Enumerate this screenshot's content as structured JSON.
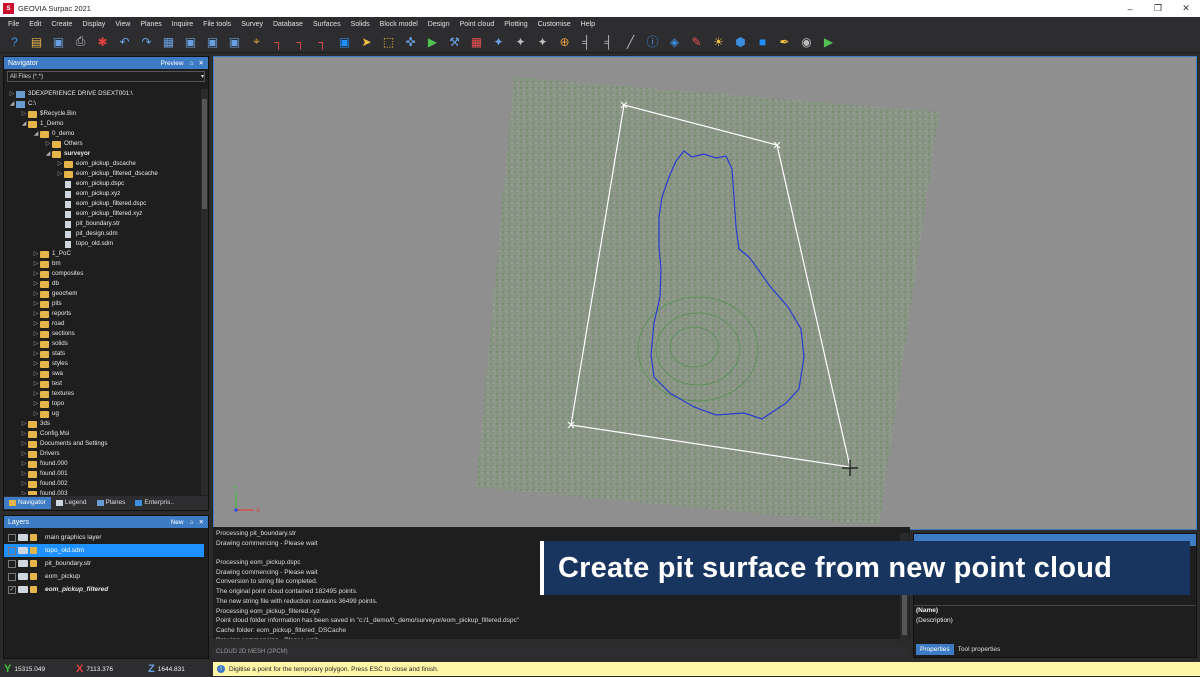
{
  "window": {
    "title": "GEOVIA Surpac 2021",
    "app_icon_letter": "S",
    "minimize": "–",
    "restore": "❐",
    "close": "✕"
  },
  "menu": [
    "File",
    "Edit",
    "Create",
    "Display",
    "View",
    "Planes",
    "Inquire",
    "File tools",
    "Survey",
    "Database",
    "Surfaces",
    "Solids",
    "Block model",
    "Design",
    "Point cloud",
    "Plotting",
    "Customise",
    "Help"
  ],
  "toolbar": [
    {
      "name": "help-icon",
      "glyph": "?",
      "color": "#3d8fe0"
    },
    {
      "name": "open-icon",
      "glyph": "▤",
      "color": "#e6b54a"
    },
    {
      "name": "save-icon",
      "glyph": "▣",
      "color": "#6aa0e0"
    },
    {
      "name": "print-icon",
      "glyph": "⎙",
      "color": "#bbbbbb"
    },
    {
      "name": "snowflake-icon",
      "glyph": "✱",
      "color": "#e84040"
    },
    {
      "name": "undo-icon",
      "glyph": "↶",
      "color": "#6aa0e0"
    },
    {
      "name": "redo-icon",
      "glyph": "↷",
      "color": "#6aa0e0"
    },
    {
      "name": "grid-icon",
      "glyph": "▦",
      "color": "#6aa0e0"
    },
    {
      "name": "zoom-in-icon",
      "glyph": "▣",
      "color": "#6aa0e0"
    },
    {
      "name": "zoom-window-icon",
      "glyph": "▣",
      "color": "#6aa0e0"
    },
    {
      "name": "zoom-out-icon",
      "glyph": "▣",
      "color": "#6aa0e0"
    },
    {
      "name": "target-icon",
      "glyph": "⌖",
      "color": "#e8a040"
    },
    {
      "name": "axis-x-icon",
      "glyph": "┐",
      "color": "#e85050"
    },
    {
      "name": "axis-y-icon",
      "glyph": "┐",
      "color": "#e85050"
    },
    {
      "name": "axis-z-icon",
      "glyph": "┐",
      "color": "#e85050"
    },
    {
      "name": "select-icon",
      "glyph": "▣",
      "color": "#1e90ff"
    },
    {
      "name": "pointer-icon",
      "glyph": "➤",
      "color": "#f0c040"
    },
    {
      "name": "select-box-icon",
      "glyph": "⬚",
      "color": "#f0c040"
    },
    {
      "name": "move-icon",
      "glyph": "✜",
      "color": "#6aa0e0"
    },
    {
      "name": "play-icon",
      "glyph": "▶",
      "color": "#50c050"
    },
    {
      "name": "measure-icon",
      "glyph": "⚒",
      "color": "#6aa0e0"
    },
    {
      "name": "mesh-icon",
      "glyph": "▦",
      "color": "#e85050"
    },
    {
      "name": "digitise-icon",
      "glyph": "✦",
      "color": "#6aa0e0"
    },
    {
      "name": "edit-point-icon",
      "glyph": "✦",
      "color": "#bbbbbb"
    },
    {
      "name": "edit-segment-icon",
      "glyph": "✦",
      "color": "#bbbbbb"
    },
    {
      "name": "insert-point-icon",
      "glyph": "⊕",
      "color": "#e8a040"
    },
    {
      "name": "profile-icon",
      "glyph": "╡",
      "color": "#bbbbbb"
    },
    {
      "name": "section-icon",
      "glyph": "╡",
      "color": "#bbbbbb"
    },
    {
      "name": "string-icon",
      "glyph": "╱",
      "color": "#bbbbbb"
    },
    {
      "name": "info-icon",
      "glyph": "ⓘ",
      "color": "#3d8fe0"
    },
    {
      "name": "layer-icon",
      "glyph": "◈",
      "color": "#3d8fe0"
    },
    {
      "name": "pen-icon",
      "glyph": "✎",
      "color": "#e85050"
    },
    {
      "name": "sun-icon",
      "glyph": "☀",
      "color": "#f0c040"
    },
    {
      "name": "hexagon-icon",
      "glyph": "⬢",
      "color": "#3d8fe0"
    },
    {
      "name": "colour-icon",
      "glyph": "■",
      "color": "#1e90ff"
    },
    {
      "name": "draw-icon",
      "glyph": "✒",
      "color": "#f0c040"
    },
    {
      "name": "record-icon",
      "glyph": "◉",
      "color": "#bbbbbb"
    },
    {
      "name": "run-macro-icon",
      "glyph": "▶",
      "color": "#50c050"
    }
  ],
  "navigator": {
    "title": "Navigator",
    "preview_label": "Preview",
    "filter": "All Files (*.*)",
    "items": [
      {
        "depth": 0,
        "arrow": "▷",
        "icon": "drive",
        "label": "3DEXPERIENCE DRIVE DSEXT001:\\"
      },
      {
        "depth": 0,
        "arrow": "◢",
        "icon": "drive",
        "label": "C:\\"
      },
      {
        "depth": 1,
        "arrow": "▷",
        "icon": "folder",
        "label": "$Recycle.Bin"
      },
      {
        "depth": 1,
        "arrow": "◢",
        "icon": "folder",
        "label": "1_Demo"
      },
      {
        "depth": 2,
        "arrow": "◢",
        "icon": "folder",
        "label": "0_demo"
      },
      {
        "depth": 3,
        "arrow": "▷",
        "icon": "folder",
        "label": "Others"
      },
      {
        "depth": 3,
        "arrow": "◢",
        "icon": "folder",
        "label": "surveyor",
        "bold": true
      },
      {
        "depth": 4,
        "arrow": "▷",
        "icon": "folder",
        "label": "eom_pickup_dscache"
      },
      {
        "depth": 4,
        "arrow": "▷",
        "icon": "folder",
        "label": "eom_pickup_filtered_dscache"
      },
      {
        "depth": 4,
        "arrow": "",
        "icon": "file",
        "label": "eom_pickup.dspc"
      },
      {
        "depth": 4,
        "arrow": "",
        "icon": "file",
        "label": "eom_pickup.xyz"
      },
      {
        "depth": 4,
        "arrow": "",
        "icon": "file",
        "label": "eom_pickup_filtered.dspc"
      },
      {
        "depth": 4,
        "arrow": "",
        "icon": "file",
        "label": "eom_pickup_filtered.xyz"
      },
      {
        "depth": 4,
        "arrow": "",
        "icon": "file",
        "label": "pit_boundary.str"
      },
      {
        "depth": 4,
        "arrow": "",
        "icon": "file",
        "label": "pit_design.sdm"
      },
      {
        "depth": 4,
        "arrow": "",
        "icon": "file",
        "label": "topo_old.sdm"
      },
      {
        "depth": 2,
        "arrow": "▷",
        "icon": "folder",
        "label": "1_PoC"
      },
      {
        "depth": 2,
        "arrow": "▷",
        "icon": "folder",
        "label": "bm"
      },
      {
        "depth": 2,
        "arrow": "▷",
        "icon": "folder",
        "label": "composites"
      },
      {
        "depth": 2,
        "arrow": "▷",
        "icon": "folder",
        "label": "db"
      },
      {
        "depth": 2,
        "arrow": "▷",
        "icon": "folder",
        "label": "geochem"
      },
      {
        "depth": 2,
        "arrow": "▷",
        "icon": "folder",
        "label": "pits"
      },
      {
        "depth": 2,
        "arrow": "▷",
        "icon": "folder",
        "label": "reports"
      },
      {
        "depth": 2,
        "arrow": "▷",
        "icon": "folder",
        "label": "road"
      },
      {
        "depth": 2,
        "arrow": "▷",
        "icon": "folder",
        "label": "sections"
      },
      {
        "depth": 2,
        "arrow": "▷",
        "icon": "folder",
        "label": "solids"
      },
      {
        "depth": 2,
        "arrow": "▷",
        "icon": "folder",
        "label": "stats"
      },
      {
        "depth": 2,
        "arrow": "▷",
        "icon": "folder",
        "label": "styles"
      },
      {
        "depth": 2,
        "arrow": "▷",
        "icon": "folder",
        "label": "swa"
      },
      {
        "depth": 2,
        "arrow": "▷",
        "icon": "folder",
        "label": "test"
      },
      {
        "depth": 2,
        "arrow": "▷",
        "icon": "folder",
        "label": "textures"
      },
      {
        "depth": 2,
        "arrow": "▷",
        "icon": "folder",
        "label": "topo"
      },
      {
        "depth": 2,
        "arrow": "▷",
        "icon": "folder",
        "label": "ug"
      },
      {
        "depth": 1,
        "arrow": "▷",
        "icon": "folder",
        "label": "3ds"
      },
      {
        "depth": 1,
        "arrow": "▷",
        "icon": "folder",
        "label": "Config.Msi"
      },
      {
        "depth": 1,
        "arrow": "▷",
        "icon": "folder",
        "label": "Documents and Settings"
      },
      {
        "depth": 1,
        "arrow": "▷",
        "icon": "folder",
        "label": "Drivers"
      },
      {
        "depth": 1,
        "arrow": "▷",
        "icon": "folder",
        "label": "found.000"
      },
      {
        "depth": 1,
        "arrow": "▷",
        "icon": "folder",
        "label": "found.001"
      },
      {
        "depth": 1,
        "arrow": "▷",
        "icon": "folder",
        "label": "found.002"
      },
      {
        "depth": 1,
        "arrow": "▷",
        "icon": "folder",
        "label": "found.003"
      }
    ],
    "tabs": [
      {
        "label": "Navigator",
        "active": true,
        "color": "#e6b54a"
      },
      {
        "label": "Legend",
        "active": false,
        "color": "#cfd6de"
      },
      {
        "label": "Planes",
        "active": false,
        "color": "#6a9bd1"
      },
      {
        "label": "Enterpris..",
        "active": false,
        "color": "#3d8fe0"
      }
    ]
  },
  "layers": {
    "title": "Layers",
    "new_label": "New",
    "items": [
      {
        "label": "main graphics layer",
        "checked": false,
        "selected": false,
        "italic": false
      },
      {
        "label": "topo_old.sdm",
        "checked": false,
        "selected": true,
        "italic": false
      },
      {
        "label": "pit_boundary.str",
        "checked": false,
        "selected": false,
        "italic": false
      },
      {
        "label": "eom_pickup",
        "checked": false,
        "selected": false,
        "italic": false
      },
      {
        "label": "eom_pickup_filtered",
        "checked": true,
        "selected": false,
        "italic": true
      }
    ]
  },
  "output": {
    "lines": [
      "Processing pit_boundary.str",
      "Drawing commencing - Please wait",
      "",
      "Processing eom_pickup.dspc",
      "Drawing commencing - Please wait",
      "Conversion to string file completed.",
      "The original point cloud contained 182495 points.",
      "The new string file with reduction contains 36499 points.",
      "Processing eom_pickup_filtered.xyz",
      "Point cloud folder information has been saved in \"c:/1_demo/0_demo/surveyor/eom_pickup_filtered.dspc\"",
      "Cache folder: eom_pickup_filtered_DSCache",
      "Drawing commencing - Please wait"
    ],
    "tab_label": "CLOUD 2D MESH (2PCM)"
  },
  "properties": {
    "name": "(Name)",
    "description": "(Description)",
    "tabs": [
      {
        "label": "Properties",
        "active": true
      },
      {
        "label": "Tool properties",
        "active": false
      }
    ]
  },
  "banner": {
    "text": "Create pit surface from new point cloud"
  },
  "status": {
    "y_label": "Y",
    "y_value": "15315.049",
    "x_label": "X",
    "x_value": "7113.376",
    "z_label": "Z",
    "z_value": "1644.831",
    "message": "Digitise a point for the temporary polygon. Press ESC to close and finish.",
    "info_glyph": "i"
  },
  "colors": {
    "accent": "#3d7bc4",
    "selection": "#1e90ff",
    "pit_outline": "#2a3bd0",
    "polygon": "#ffffff",
    "point_cloud": "#6f8f6a"
  }
}
